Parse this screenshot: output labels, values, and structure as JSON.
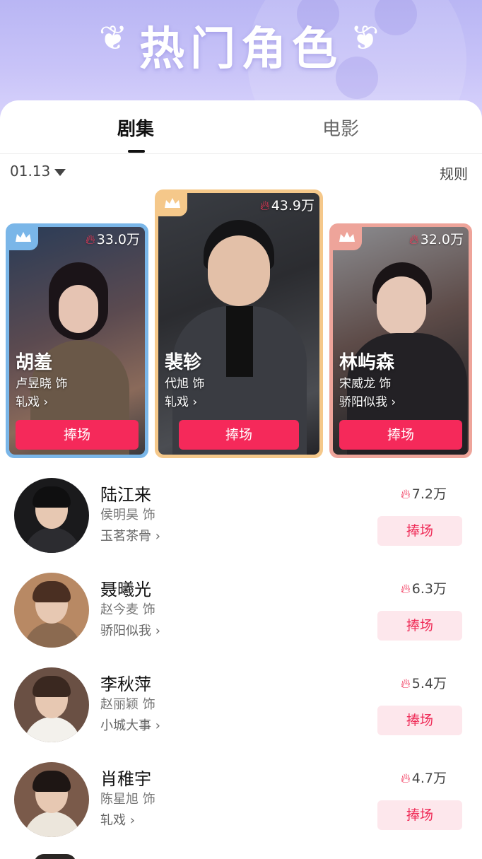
{
  "header": {
    "title": "热门角色"
  },
  "tabs": [
    {
      "label": "剧集",
      "active": true
    },
    {
      "label": "电影",
      "active": false
    }
  ],
  "date": "01.13",
  "rules_label": "规则",
  "top3": [
    {
      "rank": 2,
      "heat": "33.0万",
      "name": "胡羞",
      "actor": "卢昱晓 饰",
      "drama": "轧戏 ›",
      "button": "捧场",
      "frame_color": "#7ab6e8"
    },
    {
      "rank": 1,
      "heat": "43.9万",
      "name": "裴轸",
      "actor": "代旭 饰",
      "drama": "轧戏 ›",
      "button": "捧场",
      "frame_color": "#f5c88a"
    },
    {
      "rank": 3,
      "heat": "32.0万",
      "name": "林屿森",
      "actor": "宋威龙 饰",
      "drama": "骄阳似我 ›",
      "button": "捧场",
      "frame_color": "#eea49a"
    }
  ],
  "list": [
    {
      "name": "陆江来",
      "actor": "侯明昊 饰",
      "drama": "玉茗茶骨 ›",
      "heat": "7.2万",
      "button": "捧场"
    },
    {
      "name": "聂曦光",
      "actor": "赵今麦 饰",
      "drama": "骄阳似我 ›",
      "heat": "6.3万",
      "button": "捧场"
    },
    {
      "name": "李秋萍",
      "actor": "赵丽颖 饰",
      "drama": "小城大事 ›",
      "heat": "5.4万",
      "button": "捧场"
    },
    {
      "name": "肖稚宇",
      "actor": "陈星旭 饰",
      "drama": "轧戏 ›",
      "heat": "4.7万",
      "button": "捧场"
    }
  ],
  "colors": {
    "accent": "#f5295a",
    "banner": "#c3bff6"
  }
}
